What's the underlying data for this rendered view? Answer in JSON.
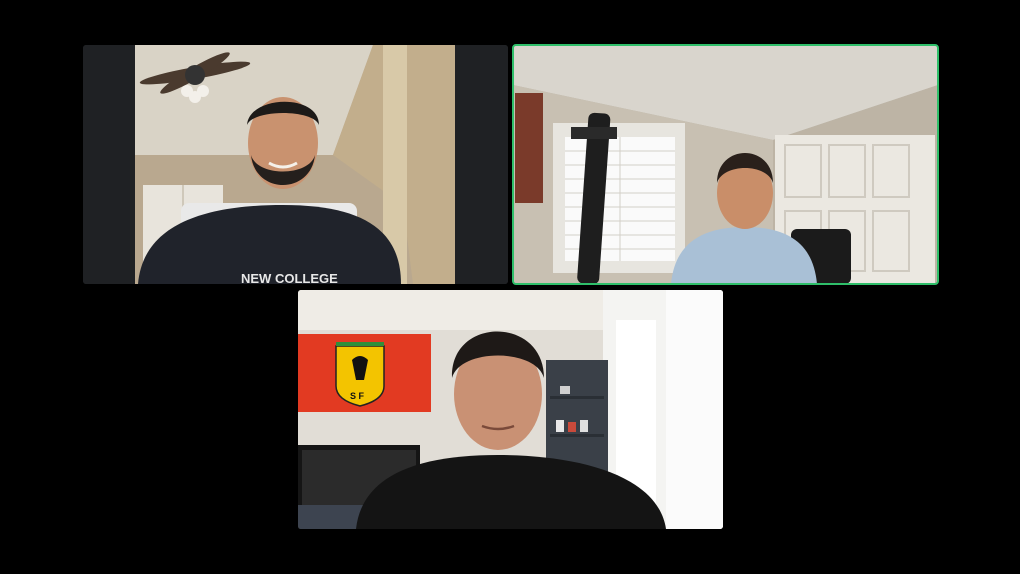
{
  "meeting": {
    "layout": "gallery-view",
    "participant_count": 3,
    "active_speaker_index": 1
  },
  "participants": [
    {
      "display_name": "",
      "shirt_text": "NEW COLLEGE",
      "speaking": false
    },
    {
      "display_name": "",
      "speaking": true
    },
    {
      "display_name": "",
      "flag_text": "S F",
      "speaking": false
    }
  ],
  "colors": {
    "background": "#000000",
    "active_speaker_border": "#2fbf6a",
    "letterbox": "#1f2124"
  }
}
